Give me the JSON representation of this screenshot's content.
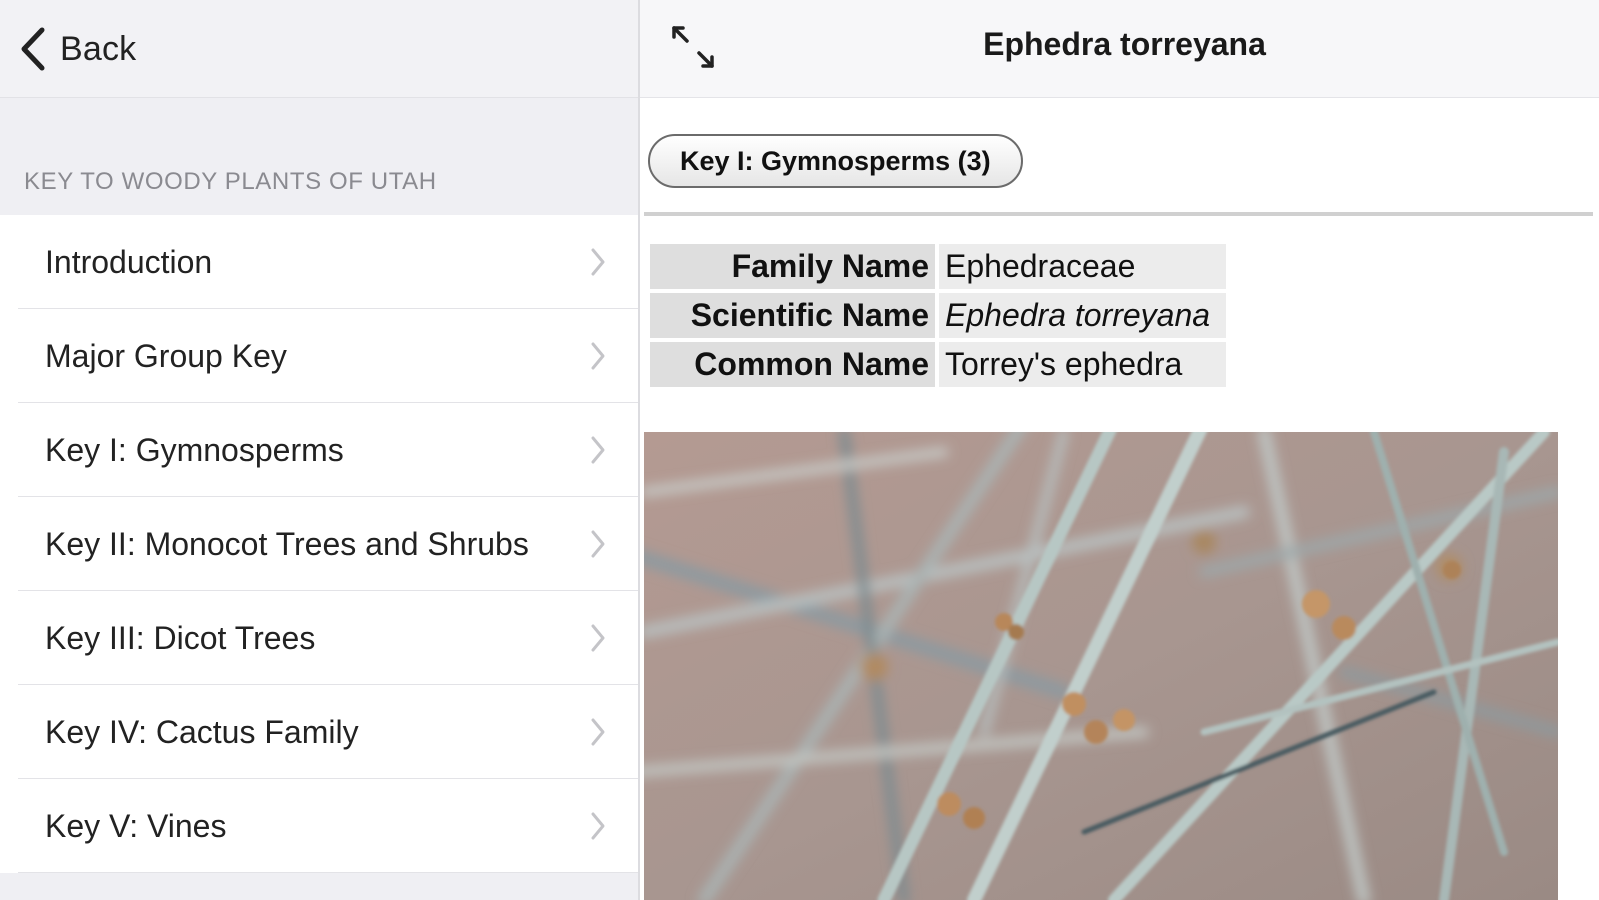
{
  "left_pane": {
    "nav": {
      "back_label": "Back"
    },
    "section_header": "KEY TO WOODY PLANTS OF UTAH",
    "items": [
      {
        "label": "Introduction"
      },
      {
        "label": "Major Group Key"
      },
      {
        "label": "Key I: Gymnosperms"
      },
      {
        "label": "Key II: Monocot Trees and Shrubs"
      },
      {
        "label": "Key III: Dicot Trees"
      },
      {
        "label": "Key IV: Cactus Family"
      },
      {
        "label": "Key V: Vines"
      }
    ]
  },
  "right_pane": {
    "title": "Ephedra torreyana",
    "key_button": "Key I: Gymnosperms (3)",
    "info": [
      {
        "label": "Family Name",
        "value": "Ephedraceae"
      },
      {
        "label": "Scientific Name",
        "value": "Ephedra torreyana"
      },
      {
        "label": "Common Name",
        "value": "Torrey's ephedra"
      }
    ]
  },
  "colors": {
    "sidebar_bg": "#efeff3",
    "nav_bg": "#f2f2f5",
    "header_text": "#8a8a90",
    "label_cell_bg": "#dedede",
    "value_cell_bg": "#ececec"
  },
  "icons": {
    "back": "chevron-left-icon",
    "row_disclosure": "chevron-right-icon",
    "expand": "expand-arrows-icon"
  }
}
